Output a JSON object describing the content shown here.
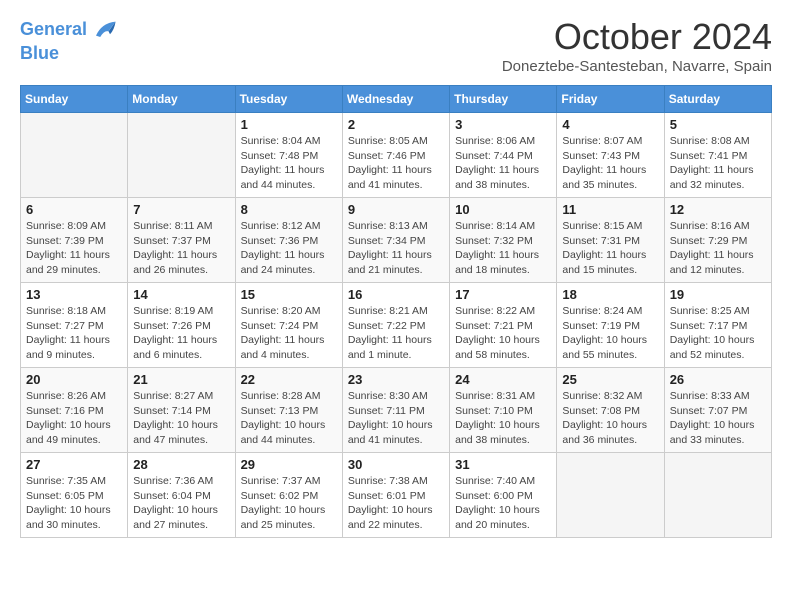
{
  "header": {
    "logo_line1": "General",
    "logo_line2": "Blue",
    "month": "October 2024",
    "location": "Doneztebe-Santesteban, Navarre, Spain"
  },
  "days_of_week": [
    "Sunday",
    "Monday",
    "Tuesday",
    "Wednesday",
    "Thursday",
    "Friday",
    "Saturday"
  ],
  "weeks": [
    [
      {
        "day": "",
        "sunrise": "",
        "sunset": "",
        "daylight": ""
      },
      {
        "day": "",
        "sunrise": "",
        "sunset": "",
        "daylight": ""
      },
      {
        "day": "1",
        "sunrise": "Sunrise: 8:04 AM",
        "sunset": "Sunset: 7:48 PM",
        "daylight": "Daylight: 11 hours and 44 minutes."
      },
      {
        "day": "2",
        "sunrise": "Sunrise: 8:05 AM",
        "sunset": "Sunset: 7:46 PM",
        "daylight": "Daylight: 11 hours and 41 minutes."
      },
      {
        "day": "3",
        "sunrise": "Sunrise: 8:06 AM",
        "sunset": "Sunset: 7:44 PM",
        "daylight": "Daylight: 11 hours and 38 minutes."
      },
      {
        "day": "4",
        "sunrise": "Sunrise: 8:07 AM",
        "sunset": "Sunset: 7:43 PM",
        "daylight": "Daylight: 11 hours and 35 minutes."
      },
      {
        "day": "5",
        "sunrise": "Sunrise: 8:08 AM",
        "sunset": "Sunset: 7:41 PM",
        "daylight": "Daylight: 11 hours and 32 minutes."
      }
    ],
    [
      {
        "day": "6",
        "sunrise": "Sunrise: 8:09 AM",
        "sunset": "Sunset: 7:39 PM",
        "daylight": "Daylight: 11 hours and 29 minutes."
      },
      {
        "day": "7",
        "sunrise": "Sunrise: 8:11 AM",
        "sunset": "Sunset: 7:37 PM",
        "daylight": "Daylight: 11 hours and 26 minutes."
      },
      {
        "day": "8",
        "sunrise": "Sunrise: 8:12 AM",
        "sunset": "Sunset: 7:36 PM",
        "daylight": "Daylight: 11 hours and 24 minutes."
      },
      {
        "day": "9",
        "sunrise": "Sunrise: 8:13 AM",
        "sunset": "Sunset: 7:34 PM",
        "daylight": "Daylight: 11 hours and 21 minutes."
      },
      {
        "day": "10",
        "sunrise": "Sunrise: 8:14 AM",
        "sunset": "Sunset: 7:32 PM",
        "daylight": "Daylight: 11 hours and 18 minutes."
      },
      {
        "day": "11",
        "sunrise": "Sunrise: 8:15 AM",
        "sunset": "Sunset: 7:31 PM",
        "daylight": "Daylight: 11 hours and 15 minutes."
      },
      {
        "day": "12",
        "sunrise": "Sunrise: 8:16 AM",
        "sunset": "Sunset: 7:29 PM",
        "daylight": "Daylight: 11 hours and 12 minutes."
      }
    ],
    [
      {
        "day": "13",
        "sunrise": "Sunrise: 8:18 AM",
        "sunset": "Sunset: 7:27 PM",
        "daylight": "Daylight: 11 hours and 9 minutes."
      },
      {
        "day": "14",
        "sunrise": "Sunrise: 8:19 AM",
        "sunset": "Sunset: 7:26 PM",
        "daylight": "Daylight: 11 hours and 6 minutes."
      },
      {
        "day": "15",
        "sunrise": "Sunrise: 8:20 AM",
        "sunset": "Sunset: 7:24 PM",
        "daylight": "Daylight: 11 hours and 4 minutes."
      },
      {
        "day": "16",
        "sunrise": "Sunrise: 8:21 AM",
        "sunset": "Sunset: 7:22 PM",
        "daylight": "Daylight: 11 hours and 1 minute."
      },
      {
        "day": "17",
        "sunrise": "Sunrise: 8:22 AM",
        "sunset": "Sunset: 7:21 PM",
        "daylight": "Daylight: 10 hours and 58 minutes."
      },
      {
        "day": "18",
        "sunrise": "Sunrise: 8:24 AM",
        "sunset": "Sunset: 7:19 PM",
        "daylight": "Daylight: 10 hours and 55 minutes."
      },
      {
        "day": "19",
        "sunrise": "Sunrise: 8:25 AM",
        "sunset": "Sunset: 7:17 PM",
        "daylight": "Daylight: 10 hours and 52 minutes."
      }
    ],
    [
      {
        "day": "20",
        "sunrise": "Sunrise: 8:26 AM",
        "sunset": "Sunset: 7:16 PM",
        "daylight": "Daylight: 10 hours and 49 minutes."
      },
      {
        "day": "21",
        "sunrise": "Sunrise: 8:27 AM",
        "sunset": "Sunset: 7:14 PM",
        "daylight": "Daylight: 10 hours and 47 minutes."
      },
      {
        "day": "22",
        "sunrise": "Sunrise: 8:28 AM",
        "sunset": "Sunset: 7:13 PM",
        "daylight": "Daylight: 10 hours and 44 minutes."
      },
      {
        "day": "23",
        "sunrise": "Sunrise: 8:30 AM",
        "sunset": "Sunset: 7:11 PM",
        "daylight": "Daylight: 10 hours and 41 minutes."
      },
      {
        "day": "24",
        "sunrise": "Sunrise: 8:31 AM",
        "sunset": "Sunset: 7:10 PM",
        "daylight": "Daylight: 10 hours and 38 minutes."
      },
      {
        "day": "25",
        "sunrise": "Sunrise: 8:32 AM",
        "sunset": "Sunset: 7:08 PM",
        "daylight": "Daylight: 10 hours and 36 minutes."
      },
      {
        "day": "26",
        "sunrise": "Sunrise: 8:33 AM",
        "sunset": "Sunset: 7:07 PM",
        "daylight": "Daylight: 10 hours and 33 minutes."
      }
    ],
    [
      {
        "day": "27",
        "sunrise": "Sunrise: 7:35 AM",
        "sunset": "Sunset: 6:05 PM",
        "daylight": "Daylight: 10 hours and 30 minutes."
      },
      {
        "day": "28",
        "sunrise": "Sunrise: 7:36 AM",
        "sunset": "Sunset: 6:04 PM",
        "daylight": "Daylight: 10 hours and 27 minutes."
      },
      {
        "day": "29",
        "sunrise": "Sunrise: 7:37 AM",
        "sunset": "Sunset: 6:02 PM",
        "daylight": "Daylight: 10 hours and 25 minutes."
      },
      {
        "day": "30",
        "sunrise": "Sunrise: 7:38 AM",
        "sunset": "Sunset: 6:01 PM",
        "daylight": "Daylight: 10 hours and 22 minutes."
      },
      {
        "day": "31",
        "sunrise": "Sunrise: 7:40 AM",
        "sunset": "Sunset: 6:00 PM",
        "daylight": "Daylight: 10 hours and 20 minutes."
      },
      {
        "day": "",
        "sunrise": "",
        "sunset": "",
        "daylight": ""
      },
      {
        "day": "",
        "sunrise": "",
        "sunset": "",
        "daylight": ""
      }
    ]
  ]
}
